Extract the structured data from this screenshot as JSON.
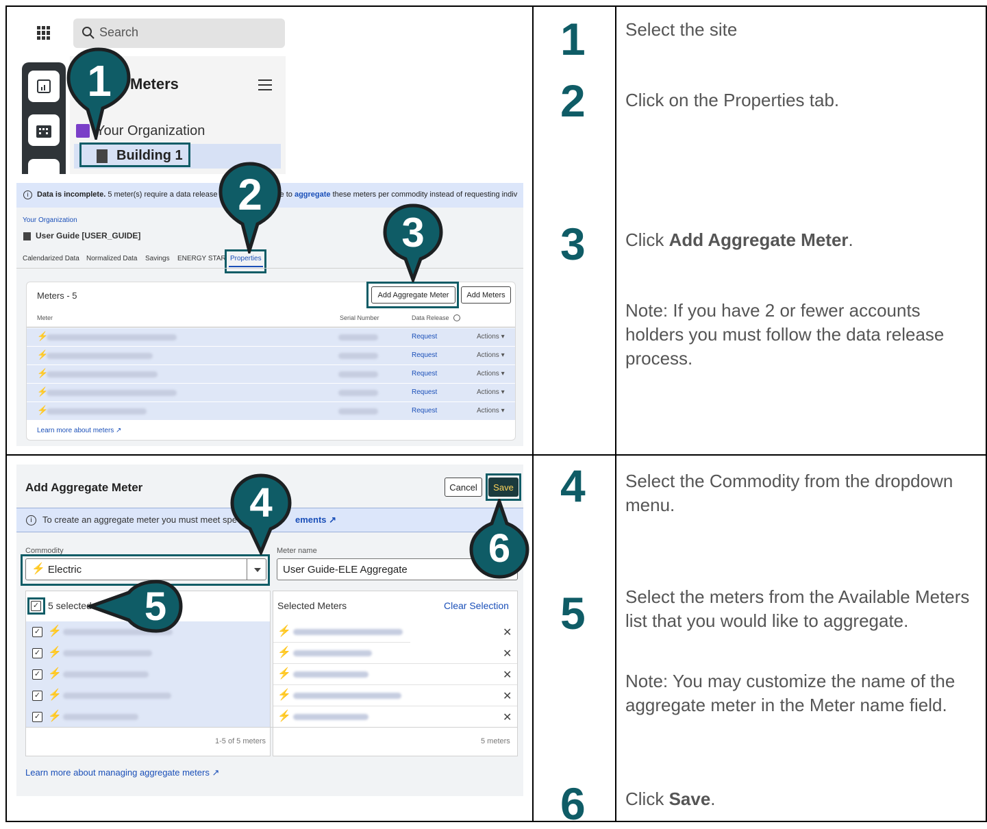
{
  "steps": [
    {
      "num": "1",
      "text": "Select the site"
    },
    {
      "num": "2",
      "text": "Click on the Properties tab."
    },
    {
      "num": "3",
      "text_prefix": "Click ",
      "text_bold": "Add Aggregate Meter",
      "text_suffix": ".",
      "note": "Note: If you have 2 or fewer accounts holders you must follow the data release process."
    },
    {
      "num": "4",
      "text": "Select the Commodity from the dropdown menu."
    },
    {
      "num": "5",
      "text": "Select the meters from the Available Meters list that you would like to aggregate.",
      "note": "Note: You may customize the name of the aggregate meter in the Meter name field."
    },
    {
      "num": "6",
      "text_prefix": "Click ",
      "text_bold": "Save",
      "text_suffix": "."
    }
  ],
  "shot1": {
    "search_placeholder": "Search",
    "nav_title": "Meters",
    "org": "Your Organization",
    "building": "Building 1"
  },
  "shot2": {
    "banner_bold": "Data is incomplete.",
    "banner_text": " 5 meter(s) require a data release",
    "banner_text2": "ble to ",
    "banner_link": "aggregate",
    "banner_text3": " these meters per commodity instead of requesting indiv",
    "breadcrumb": "Your Organization",
    "title": "User Guide [USER_GUIDE]",
    "tabs": [
      "Calendarized Data",
      "Normalized Data",
      "Savings",
      "ENERGY STAR",
      "Properties"
    ],
    "meters_title": "Meters - 5",
    "add_aggregate": "Add Aggregate Meter",
    "add_meters": "Add Meters",
    "col_meter": "Meter",
    "col_serial": "Serial Number",
    "col_release": "Data Release",
    "rows": [
      {
        "release": "Request",
        "actions": "Actions"
      },
      {
        "release": "Request",
        "actions": "Actions"
      },
      {
        "release": "Request",
        "actions": "Actions"
      },
      {
        "release": "Request",
        "actions": "Actions"
      },
      {
        "release": "Request",
        "actions": "Actions"
      }
    ],
    "learn_more": "Learn more about meters"
  },
  "shot3": {
    "title": "Add Aggregate Meter",
    "cancel": "Cancel",
    "save": "Save",
    "banner_text": "To create an aggregate meter you must meet spe",
    "banner_link": "ements",
    "commodity_label": "Commodity",
    "commodity_value": "Electric",
    "meter_name_label": "Meter name",
    "meter_name_value": "User Guide-ELE Aggregate",
    "selected_count": "5 selected",
    "selected_meters": "Selected Meters",
    "clear_selection": "Clear Selection",
    "left_footer": "1-5 of 5 meters",
    "right_footer": "5 meters",
    "learn_more": "Learn more about managing aggregate meters"
  },
  "pins": [
    "1",
    "2",
    "3",
    "4",
    "5",
    "6"
  ],
  "colors": {
    "accent": "#0f5c66",
    "link": "#1a4fb8",
    "bolt": "#f4a300",
    "highlight": "#dce6fa"
  }
}
